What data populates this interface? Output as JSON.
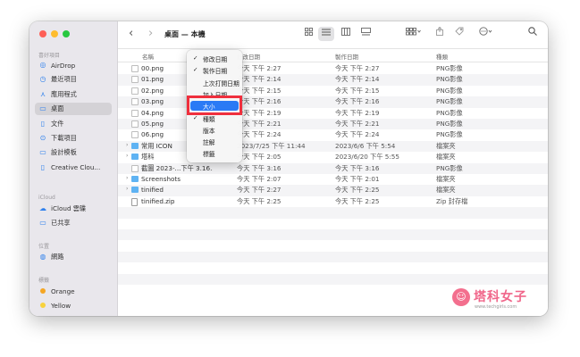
{
  "window": {
    "title": "桌面 — 本機",
    "nav_back": "‹",
    "nav_forward": "›"
  },
  "sidebar": {
    "favorites_header": "喜好項目",
    "favorites": [
      {
        "label": "AirDrop",
        "icon": "airdrop-icon",
        "glyph": "◎"
      },
      {
        "label": "最近項目",
        "icon": "clock-icon",
        "glyph": "◷"
      },
      {
        "label": "應用程式",
        "icon": "apps-icon",
        "glyph": "⋏"
      },
      {
        "label": "桌面",
        "icon": "desktop-icon",
        "glyph": "▭"
      },
      {
        "label": "文件",
        "icon": "document-icon",
        "glyph": "▯"
      },
      {
        "label": "下載項目",
        "icon": "download-icon",
        "glyph": "⊙"
      },
      {
        "label": "設計模板",
        "icon": "folder-icon",
        "glyph": "▭"
      },
      {
        "label": "Creative Clou...",
        "icon": "file-icon",
        "glyph": "▯"
      }
    ],
    "icloud_header": "iCloud",
    "icloud": [
      {
        "label": "iCloud 雲碟",
        "icon": "cloud-icon",
        "glyph": "☁"
      },
      {
        "label": "已共享",
        "icon": "shared-folder-icon",
        "glyph": "▭"
      }
    ],
    "locations_header": "位置",
    "locations": [
      {
        "label": "網路",
        "icon": "network-icon",
        "glyph": "◍"
      }
    ],
    "tags_header": "標籤",
    "tags": [
      {
        "label": "Orange",
        "color": "#f5a623"
      },
      {
        "label": "Yellow",
        "color": "#f8d23c"
      }
    ]
  },
  "columns": {
    "name": "名稱",
    "modified": "修改日期",
    "created": "製作日期",
    "kind": "種類"
  },
  "files": [
    {
      "name": "00.png",
      "modified": "今天 下午 2:27",
      "created": "今天 下午 2:27",
      "kind": "PNG影像",
      "type": "img"
    },
    {
      "name": "01.png",
      "modified": "今天 下午 2:14",
      "created": "今天 下午 2:14",
      "kind": "PNG影像",
      "type": "img"
    },
    {
      "name": "02.png",
      "modified": "今天 下午 2:15",
      "created": "今天 下午 2:15",
      "kind": "PNG影像",
      "type": "img"
    },
    {
      "name": "03.png",
      "modified": "今天 下午 2:16",
      "created": "今天 下午 2:16",
      "kind": "PNG影像",
      "type": "img"
    },
    {
      "name": "04.png",
      "modified": "今天 下午 2:19",
      "created": "今天 下午 2:19",
      "kind": "PNG影像",
      "type": "img"
    },
    {
      "name": "05.png",
      "modified": "今天 下午 2:21",
      "created": "今天 下午 2:21",
      "kind": "PNG影像",
      "type": "img"
    },
    {
      "name": "06.png",
      "modified": "今天 下午 2:24",
      "created": "今天 下午 2:24",
      "kind": "PNG影像",
      "type": "img"
    },
    {
      "name": "常用 ICON",
      "modified": "2023/7/25 下午 11:44",
      "created": "2023/6/6 下午 5:54",
      "kind": "檔案夾",
      "type": "folder"
    },
    {
      "name": "塔科",
      "modified": "今天 下午 2:05",
      "created": "2023/6/20 下午 5:55",
      "kind": "檔案夾",
      "type": "folder"
    },
    {
      "name": "截圖 2023-...下午 3.16.54",
      "modified": "今天 下午 3:16",
      "created": "今天 下午 3:16",
      "kind": "PNG影像",
      "type": "img"
    },
    {
      "name": "Screenshots",
      "modified": "今天 下午 2:07",
      "created": "今天 下午 2:01",
      "kind": "檔案夾",
      "type": "folder"
    },
    {
      "name": "tinified",
      "modified": "今天 下午 2:27",
      "created": "今天 下午 2:25",
      "kind": "檔案夾",
      "type": "folder"
    },
    {
      "name": "tinified.zip",
      "modified": "今天 下午 2:25",
      "created": "今天 下午 2:25",
      "kind": "Zip 封存檔",
      "type": "zip"
    }
  ],
  "context_menu": {
    "items": [
      {
        "label": "修改日期",
        "checked": true
      },
      {
        "label": "製作日期",
        "checked": true
      },
      {
        "label": "上次打開日期",
        "checked": false
      },
      {
        "label": "加入日期",
        "checked": false
      },
      {
        "label": "大小",
        "checked": false,
        "highlighted": true
      },
      {
        "label": "種類",
        "checked": true
      },
      {
        "label": "版本",
        "checked": false
      },
      {
        "label": "註解",
        "checked": false
      },
      {
        "label": "標籤",
        "checked": false
      }
    ]
  },
  "watermark": {
    "text": "塔科女子",
    "url": "www.techgirls.com"
  }
}
